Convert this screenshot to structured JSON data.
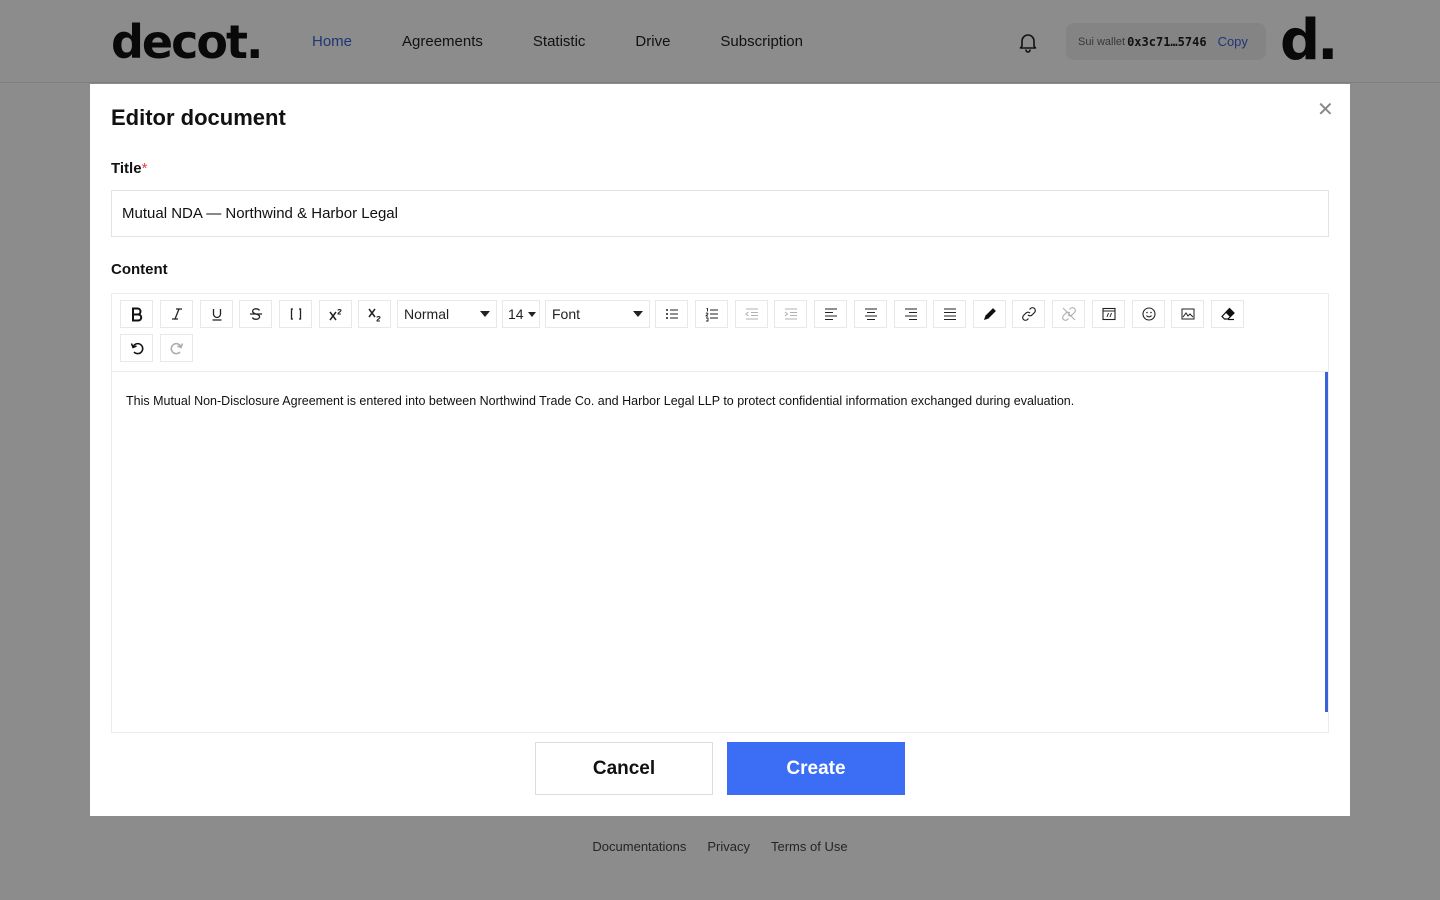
{
  "header": {
    "logo": "decot.",
    "nav": [
      "Home",
      "Agreements",
      "Statistic",
      "Drive",
      "Subscription"
    ],
    "active_nav": "Home",
    "wallet_label": "Sui wallet",
    "wallet_address": "0x3c71…5746",
    "copy_label": "Copy",
    "avatar_logo": "d."
  },
  "footer": {
    "links": [
      "Documentations",
      "Privacy",
      "Terms of Use"
    ]
  },
  "modal": {
    "title": "Editor document",
    "close_icon": "close-icon",
    "title_label": "Title",
    "title_required_mark": "*",
    "title_value": "Mutual NDA — Northwind & Harbor Legal",
    "content_label": "Content",
    "toolbar": {
      "block_format": "Normal",
      "font_size": "14",
      "font": "Font",
      "icons": [
        "bold-icon",
        "italic-icon",
        "underline-icon",
        "strikethrough-icon",
        "code-icon",
        "superscript-icon",
        "subscript-icon",
        "bullet-list-icon",
        "numbered-list-icon",
        "outdent-icon",
        "indent-icon",
        "align-left-icon",
        "align-center-icon",
        "align-right-icon",
        "align-justify-icon",
        "color-icon",
        "link-icon",
        "unlink-icon",
        "embed-icon",
        "emoji-icon",
        "image-icon",
        "eraser-icon",
        "undo-icon",
        "redo-icon"
      ]
    },
    "content_text": "This Mutual Non-Disclosure Agreement is entered into between Northwind Trade Co. and Harbor Legal LLP to protect confidential information exchanged during evaluation.",
    "cancel_label": "Cancel",
    "create_label": "Create"
  },
  "colors": {
    "accent": "#3b63d9",
    "primary_button": "#3b6ef5",
    "required": "#e0443d"
  }
}
